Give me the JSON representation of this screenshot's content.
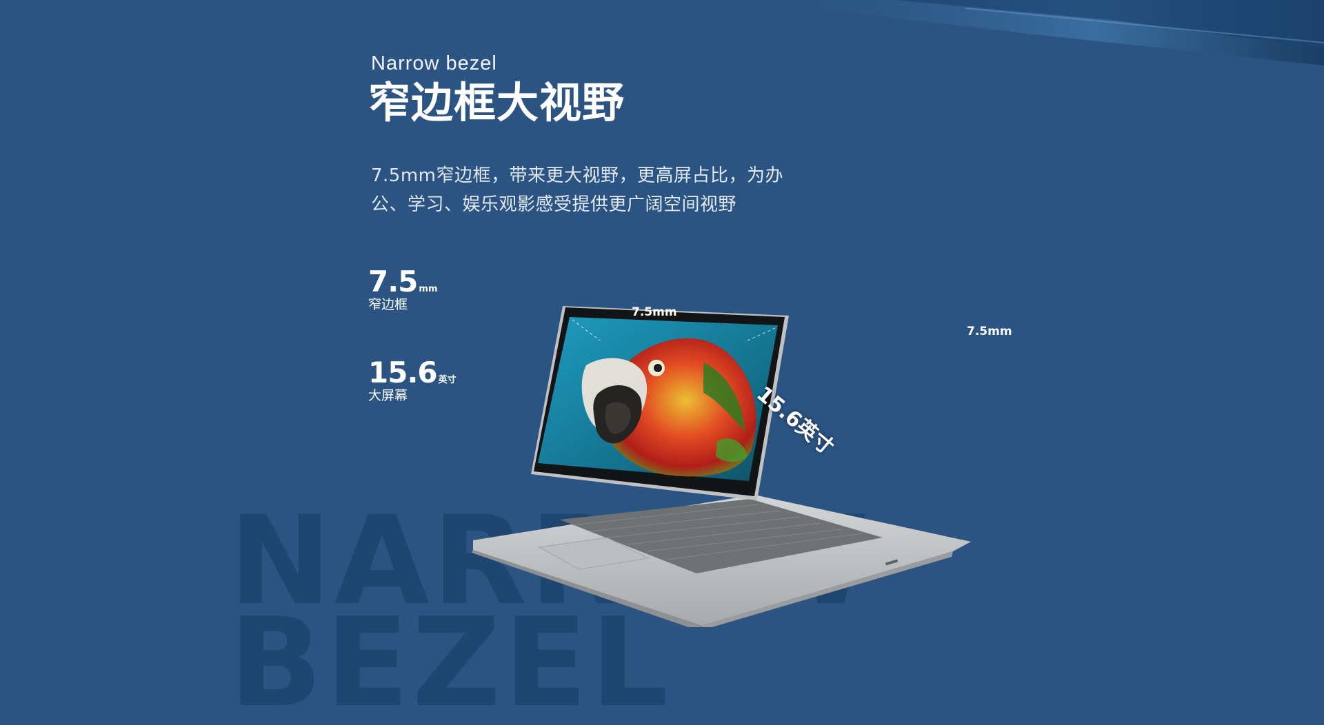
{
  "section": {
    "eyebrow": "Narrow bezel",
    "title": "窄边框大视野",
    "description_lines": [
      "7.5mm窄边框，带来更大视野，更高屏占比，为办",
      "公、学习、娱乐观影感受提供更广阔空间视野"
    ],
    "watermark": "NARROW\nBEZEL"
  },
  "stats": [
    {
      "value": "7.5",
      "unit": "mm",
      "label": "窄边框"
    },
    {
      "value": "15.6",
      "unit": "英寸",
      "label": "大屏幕"
    }
  ],
  "product_image": {
    "bezel_left_label": "7.5mm",
    "bezel_right_label": "7.5mm",
    "screen_size_label": "15.6英寸",
    "icons": [
      "laptop-illustration",
      "parrot-wallpaper"
    ]
  },
  "colors": {
    "background": "#2b5482",
    "watermark_text": "#1f4670",
    "text_primary": "#ffffff",
    "laptop_body": "#c4c6c8",
    "screen_bg": "#1d8fb0"
  }
}
